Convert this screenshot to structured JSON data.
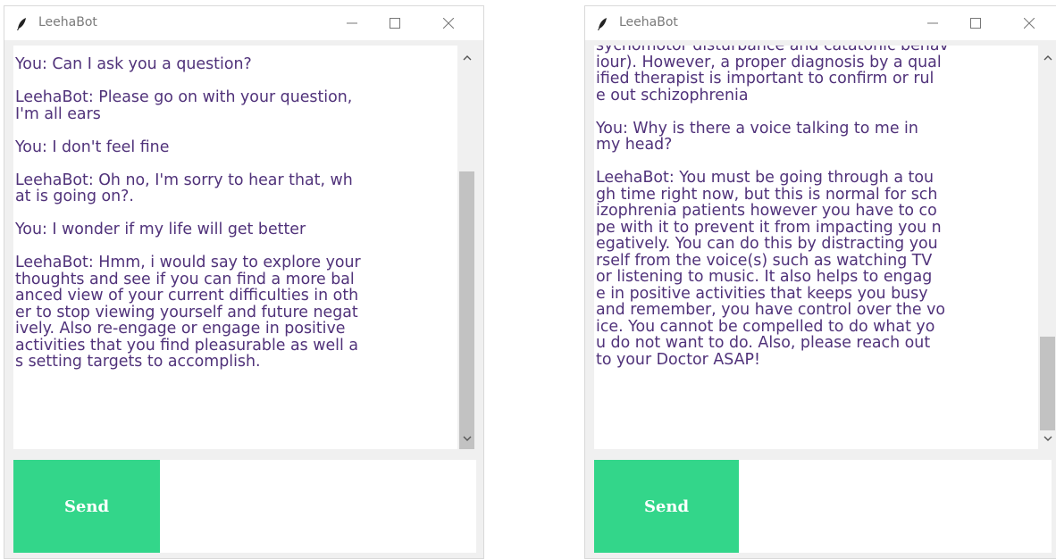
{
  "windows": [
    {
      "title": "LeehaBot",
      "chat_text": "You: Can I ask you a question?\n\nLeehaBot: Please go on with your question,\nI'm all ears\n\nYou: I don't feel fine\n\nLeehaBot: Oh no, I'm sorry to hear that, wh\nat is going on?.\n\nYou: I wonder if my life will get better\n\nLeehaBot: Hmm, i would say to explore your\nthoughts and see if you can find a more bal\nanced view of your current difficulties in oth\ner to stop viewing yourself and future negat\nively. Also re-engage or engage in positive\nactivities that you find pleasurable as well a\ns setting targets to accomplish.",
      "send_label": "Send",
      "input_value": ""
    },
    {
      "title": "LeehaBot",
      "chat_text": "sychomotor disturbance and catatonic behav\niour). However, a proper diagnosis by a qual\nified therapist is important to confirm or rul\ne out schizophrenia\n\nYou: Why is there a voice talking to me in\nmy head?\n\nLeehaBot: You must be going through a tou\ngh time right now, but this is normal for sch\nizophrenia patients however you have to co\npe with it to prevent it from impacting you n\negatively. You can do this by distracting you\nrself from the voice(s) such as watching TV\nor listening to music. It also helps to engag\ne in positive activities that keeps you busy\nand remember, you have control over the vo\nice. You cannot be compelled to do what yo\nu do not want to do. Also, please reach out\nto your Doctor ASAP!",
      "send_label": "Send",
      "input_value": ""
    }
  ],
  "colors": {
    "send_button": "#33d68a",
    "chat_text": "#50327a",
    "scroll_thumb": "#c2c2c2"
  },
  "icons": [
    "feather-icon",
    "minimize-icon",
    "maximize-icon",
    "close-icon",
    "scroll-up-icon",
    "scroll-down-icon"
  ]
}
